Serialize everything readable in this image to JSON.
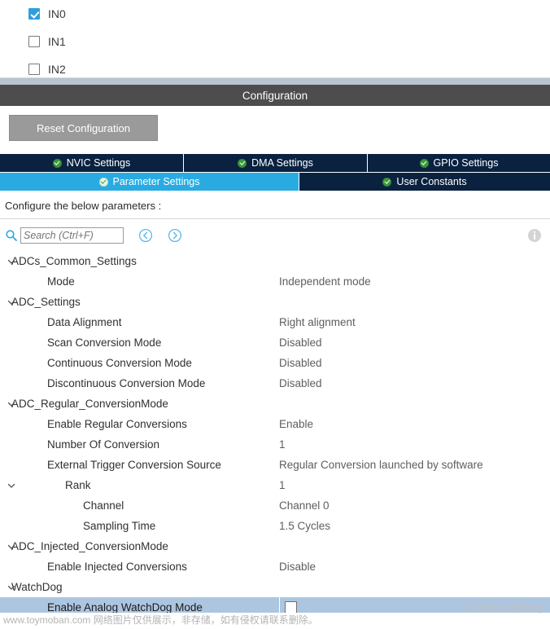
{
  "channels": {
    "items": [
      {
        "label": "IN0",
        "checked": true
      },
      {
        "label": "IN1",
        "checked": false
      },
      {
        "label": "IN2",
        "checked": false
      }
    ]
  },
  "config_bar": {
    "title": "Configuration"
  },
  "toolbar": {
    "reset_label": "Reset Configuration"
  },
  "tabs_row1": [
    {
      "label": "NVIC Settings",
      "active": false
    },
    {
      "label": "DMA Settings",
      "active": false
    },
    {
      "label": "GPIO Settings",
      "active": false
    }
  ],
  "tabs_row2": [
    {
      "label": "Parameter Settings",
      "active": true
    },
    {
      "label": "User Constants",
      "active": false
    }
  ],
  "instruction": {
    "text": "Configure the below parameters :"
  },
  "search": {
    "placeholder": "Search (Ctrl+F)",
    "value": "",
    "prev_label": "previous-match",
    "next_label": "next-match"
  },
  "tree": {
    "rows": [
      {
        "label": "ADCs_Common_Settings",
        "value": "",
        "indent": 0,
        "chevron": true,
        "chevron_indent": 0,
        "group": true,
        "selected": false,
        "checkbox": false
      },
      {
        "label": "Mode",
        "value": "Independent mode",
        "indent": 2,
        "chevron": false,
        "chevron_indent": 0,
        "group": false,
        "selected": false,
        "checkbox": false
      },
      {
        "label": "ADC_Settings",
        "value": "",
        "indent": 0,
        "chevron": true,
        "chevron_indent": 0,
        "group": true,
        "selected": false,
        "checkbox": false
      },
      {
        "label": "Data Alignment",
        "value": "Right alignment",
        "indent": 2,
        "chevron": false,
        "chevron_indent": 0,
        "group": false,
        "selected": false,
        "checkbox": false
      },
      {
        "label": "Scan Conversion Mode",
        "value": "Disabled",
        "indent": 2,
        "chevron": false,
        "chevron_indent": 0,
        "group": false,
        "selected": false,
        "checkbox": false
      },
      {
        "label": "Continuous Conversion Mode",
        "value": "Disabled",
        "indent": 2,
        "chevron": false,
        "chevron_indent": 0,
        "group": false,
        "selected": false,
        "checkbox": false
      },
      {
        "label": "Discontinuous Conversion Mode",
        "value": "Disabled",
        "indent": 2,
        "chevron": false,
        "chevron_indent": 0,
        "group": false,
        "selected": false,
        "checkbox": false
      },
      {
        "label": "ADC_Regular_ConversionMode",
        "value": "",
        "indent": 0,
        "chevron": true,
        "chevron_indent": 0,
        "group": true,
        "selected": false,
        "checkbox": false
      },
      {
        "label": "Enable Regular Conversions",
        "value": "Enable",
        "indent": 2,
        "chevron": false,
        "chevron_indent": 0,
        "group": false,
        "selected": false,
        "checkbox": false
      },
      {
        "label": "Number Of Conversion",
        "value": "1",
        "indent": 2,
        "chevron": false,
        "chevron_indent": 0,
        "group": false,
        "selected": false,
        "checkbox": false
      },
      {
        "label": "External Trigger Conversion Source",
        "value": "Regular Conversion launched by software",
        "indent": 2,
        "chevron": false,
        "chevron_indent": 0,
        "group": false,
        "selected": false,
        "checkbox": false
      },
      {
        "label": "Rank",
        "value": "1",
        "indent": 3,
        "chevron": true,
        "chevron_indent": 0,
        "group": false,
        "selected": false,
        "checkbox": false
      },
      {
        "label": "Channel",
        "value": "Channel 0",
        "indent": 4,
        "chevron": false,
        "chevron_indent": 0,
        "group": false,
        "selected": false,
        "checkbox": false
      },
      {
        "label": "Sampling Time",
        "value": "1.5 Cycles",
        "indent": 4,
        "chevron": false,
        "chevron_indent": 0,
        "group": false,
        "selected": false,
        "checkbox": false
      },
      {
        "label": "ADC_Injected_ConversionMode",
        "value": "",
        "indent": 0,
        "chevron": true,
        "chevron_indent": 0,
        "group": true,
        "selected": false,
        "checkbox": false
      },
      {
        "label": "Enable Injected Conversions",
        "value": "Disable",
        "indent": 2,
        "chevron": false,
        "chevron_indent": 0,
        "group": false,
        "selected": false,
        "checkbox": false
      },
      {
        "label": "WatchDog",
        "value": "",
        "indent": 0,
        "chevron": true,
        "chevron_indent": 0,
        "group": true,
        "selected": false,
        "checkbox": false
      },
      {
        "label": "Enable Analog WatchDog Mode",
        "value": "",
        "indent": 2,
        "chevron": false,
        "chevron_indent": 0,
        "group": false,
        "selected": true,
        "checkbox": true,
        "checkbox_checked": false
      }
    ]
  },
  "watermarks": {
    "bottom": "www.toymoban.com 网络图片仅供展示，非存储，如有侵权请联系删除。",
    "csdn": "CSDN @趣知boy"
  },
  "colors": {
    "tab_dark": "#0a2240",
    "tab_active": "#29abe2",
    "config_bar": "#4d4d4d",
    "selected_row": "#adc6e0",
    "checkbox_blue": "#2e9fdd",
    "divider_band": "#b8c4cf"
  }
}
